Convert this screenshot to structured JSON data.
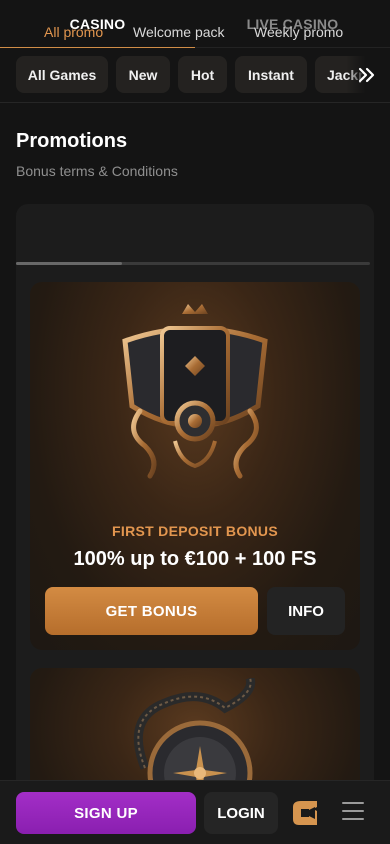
{
  "top_tabs": {
    "casino": "CASINO",
    "live_casino": "LIVE CASINO"
  },
  "categories": [
    "All Games",
    "New",
    "Hot",
    "Instant",
    "Jackpot"
  ],
  "page": {
    "title": "Promotions",
    "subtitle": "Bonus terms & Conditions"
  },
  "promo_tabs": {
    "all": "All promo",
    "welcome": "Welcome pack",
    "weekly": "Weekly promo"
  },
  "cards": [
    {
      "label": "FIRST DEPOSIT BONUS",
      "title": "100% up to €100 + 100 FS",
      "primary_button": "GET BONUS",
      "secondary_button": "INFO"
    }
  ],
  "bottom_bar": {
    "signup": "SIGN UP",
    "login": "LOGIN"
  },
  "colors": {
    "accent": "#e2964f",
    "signup": "#9b28c0",
    "bg": "#141414"
  },
  "icons": [
    "chevron-double-right-icon",
    "brand-logo-icon",
    "menu-icon"
  ]
}
